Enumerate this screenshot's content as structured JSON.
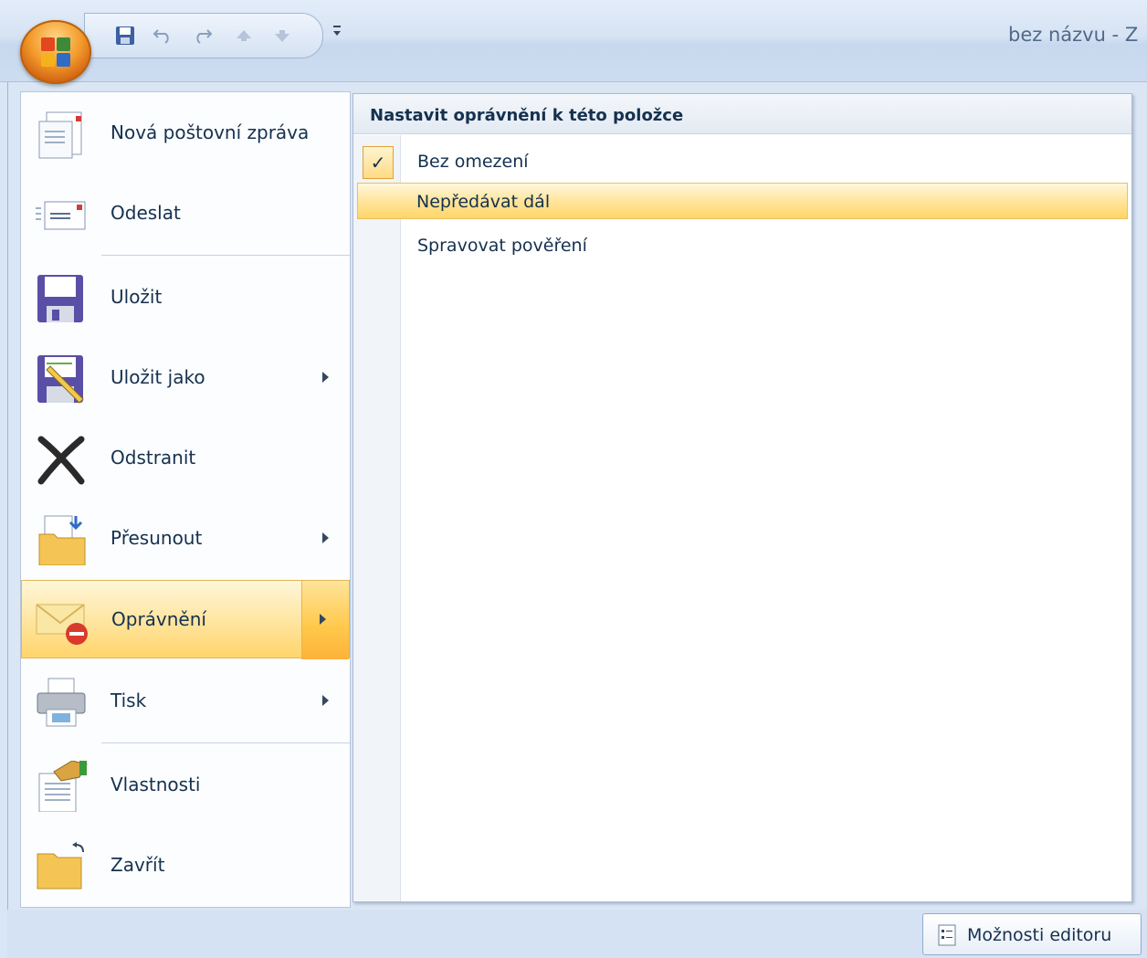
{
  "window": {
    "title": "bez názvu - Z"
  },
  "qat": {
    "buttons": [
      "save-icon",
      "undo-icon",
      "redo-icon",
      "up-arrow-icon",
      "down-arrow-icon"
    ],
    "customize": "customize-icon"
  },
  "left_menu": {
    "items": [
      {
        "label": "Nová poštovní zpráva",
        "icon": "new-mail-icon"
      },
      {
        "label": "Odeslat",
        "icon": "send-icon"
      },
      {
        "label": "Uložit",
        "icon": "save-icon"
      },
      {
        "label": "Uložit jako",
        "icon": "save-as-icon",
        "has_submenu": true
      },
      {
        "label": "Odstranit",
        "icon": "delete-icon"
      },
      {
        "label": "Přesunout",
        "icon": "move-icon",
        "has_submenu": true
      },
      {
        "label": "Oprávnění",
        "icon": "permission-icon",
        "has_submenu": true,
        "highlighted": true
      },
      {
        "label": "Tisk",
        "icon": "print-icon",
        "has_submenu": true
      },
      {
        "label": "Vlastnosti",
        "icon": "properties-icon"
      },
      {
        "label": "Zavřít",
        "icon": "close-folder-icon"
      }
    ]
  },
  "submenu": {
    "header": "Nastavit oprávnění k této položce",
    "items": [
      {
        "label": "Bez omezení",
        "checked": true
      },
      {
        "label": "Nepředávat dál",
        "highlighted": true
      },
      {
        "label": "Spravovat pověření"
      }
    ]
  },
  "bottom": {
    "options_label": "Možnosti editoru"
  },
  "colors": {
    "highlight": "#ffd56b",
    "menu_bg": "#dbe6f4",
    "text": "#15314f"
  }
}
